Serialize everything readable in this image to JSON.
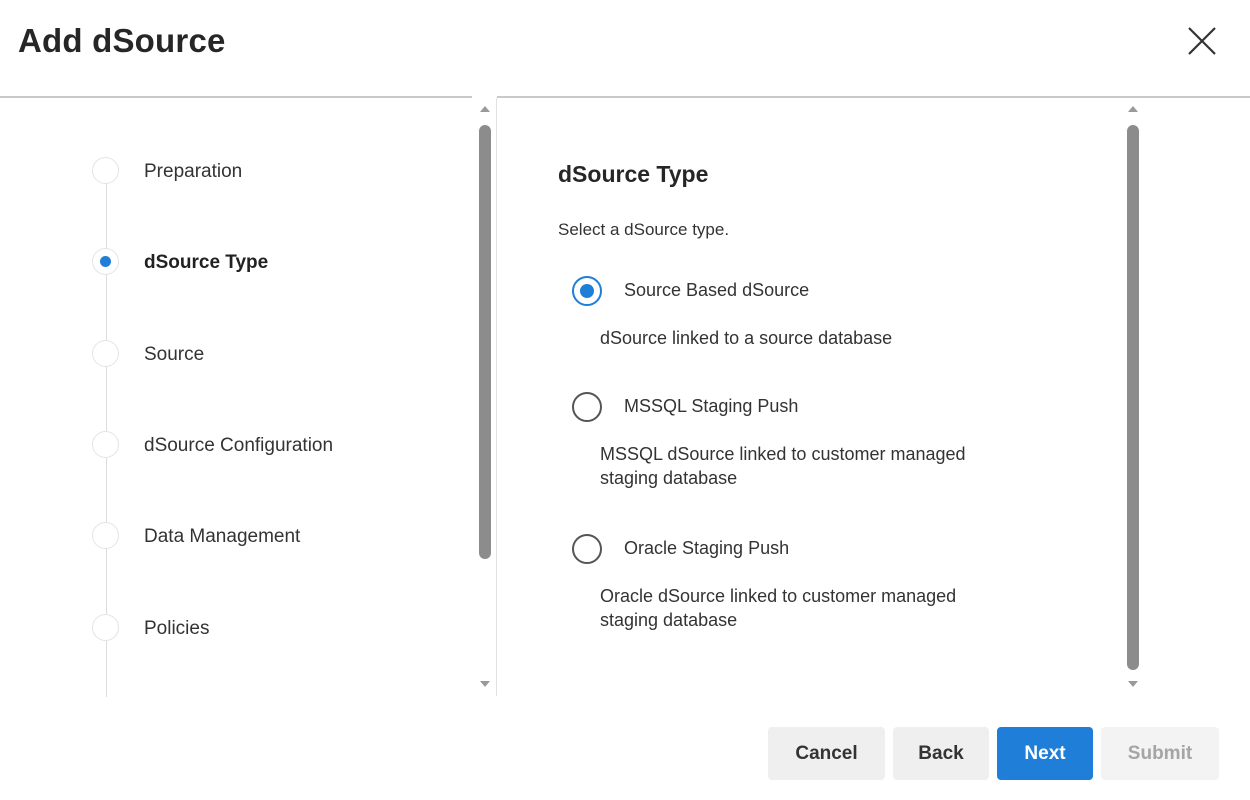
{
  "dialog": {
    "title": "Add dSource",
    "close_icon": "close-icon"
  },
  "steps": [
    {
      "label": "Preparation",
      "active": false
    },
    {
      "label": "dSource Type",
      "active": true
    },
    {
      "label": "Source",
      "active": false
    },
    {
      "label": "dSource Configuration",
      "active": false
    },
    {
      "label": "Data Management",
      "active": false
    },
    {
      "label": "Policies",
      "active": false
    }
  ],
  "content": {
    "title": "dSource Type",
    "description": "Select a dSource type.",
    "options": [
      {
        "label": "Source Based dSource",
        "description": "dSource linked to a source database",
        "selected": true
      },
      {
        "label": "MSSQL Staging Push",
        "description": "MSSQL dSource linked to customer managed staging database",
        "selected": false
      },
      {
        "label": "Oracle Staging Push",
        "description": "Oracle dSource linked to customer managed staging database",
        "selected": false
      }
    ]
  },
  "footer": {
    "cancel_label": "Cancel",
    "back_label": "Back",
    "next_label": "Next",
    "submit_label": "Submit",
    "submit_disabled": true
  },
  "colors": {
    "accent": "#1f7ed8",
    "button_secondary_bg": "#efefef",
    "button_disabled_text": "#a5a5a5"
  }
}
